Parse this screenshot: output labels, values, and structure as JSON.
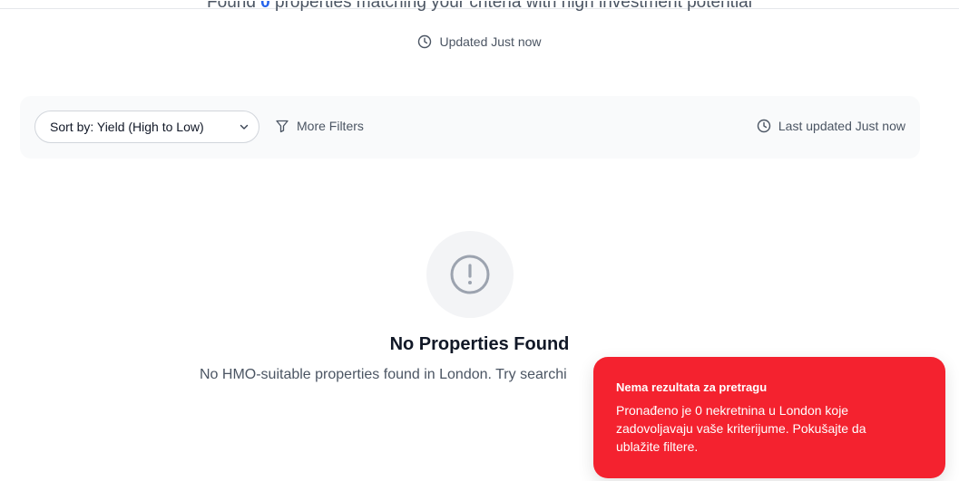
{
  "header": {
    "summary_prefix": "Found",
    "summary_count": "0",
    "summary_suffix": "properties matching your criteria with high investment potential",
    "updated_text": "Updated Just now"
  },
  "toolbar": {
    "sort_label": "Sort by: Yield (High to Low)",
    "more_filters_label": "More Filters",
    "last_updated_text": "Last updated Just now"
  },
  "empty_state": {
    "icon": "alert-circle-icon",
    "title": "No Properties Found",
    "description": "No HMO-suitable properties found in London. Try searchi"
  },
  "toast": {
    "title": "Nema rezultata za pretragu",
    "message": "Pronađeno je 0 nekretnina u London koje zadovoljavaju vaše kriterijume. Pokušajte da ublažite filtere.",
    "background_color": "#f4222f"
  },
  "colors": {
    "accent": "#2563eb",
    "muted_text": "#4b5563",
    "toolbar_bg": "#f9fafb"
  }
}
